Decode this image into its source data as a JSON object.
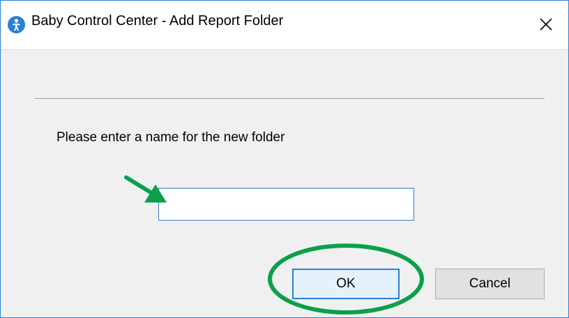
{
  "window": {
    "title": "Baby Control Center - Add Report Folder",
    "app_icon": "baby-app-icon",
    "close_icon": "close-icon"
  },
  "dialog": {
    "prompt": "Please enter a name for the new folder",
    "folder_name_value": "",
    "folder_name_placeholder": ""
  },
  "buttons": {
    "ok_label": "OK",
    "cancel_label": "Cancel"
  },
  "annotations": {
    "arrow": "green-arrow",
    "ok_highlight": "green-ellipse",
    "color": "#0aa04a"
  },
  "colors": {
    "accent": "#2b7fd6",
    "dialog_bg": "#f0f0f0"
  }
}
